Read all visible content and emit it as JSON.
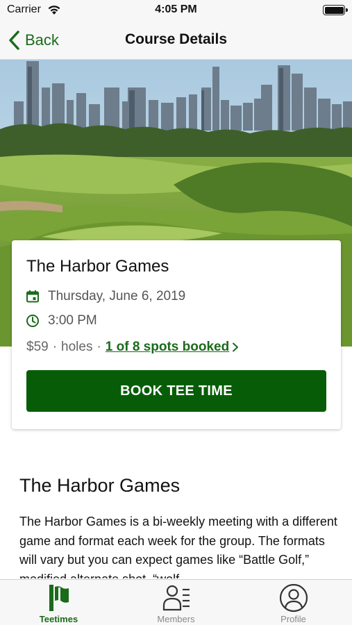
{
  "status_bar": {
    "carrier": "Carrier",
    "time": "4:05 PM"
  },
  "nav": {
    "back_label": "Back",
    "title": "Course Details"
  },
  "hero": {
    "image": "city skyline behind golf course",
    "sky_color": "#9dbfd8",
    "grass_color": "#7da73b"
  },
  "card": {
    "title": "The Harbor Games",
    "date": "Thursday, June 6, 2019",
    "time": "3:00 PM",
    "price": "$59",
    "holes": "holes",
    "spots": "1 of 8 spots booked",
    "book_label": "BOOK TEE TIME",
    "icons": {
      "date": "calendar-icon",
      "time": "clock-icon",
      "spots": "chevron-right-icon"
    }
  },
  "section": {
    "title": "The Harbor Games",
    "description": "The Harbor Games is a bi-weekly meeting with a different game and format each week for the group. The formats will vary but you can expect games like “Battle Golf,” modified alternate shot, “wolf,"
  },
  "tabs": [
    {
      "label": "Teetimes",
      "icon": "flag-icon",
      "active": true
    },
    {
      "label": "Members",
      "icon": "members-list-icon",
      "active": false
    },
    {
      "label": "Profile",
      "icon": "profile-icon",
      "active": false
    }
  ],
  "colors": {
    "brand_green": "#075d07",
    "link_green": "#1a6b1a",
    "inactive_gray": "#8a8a8a"
  }
}
